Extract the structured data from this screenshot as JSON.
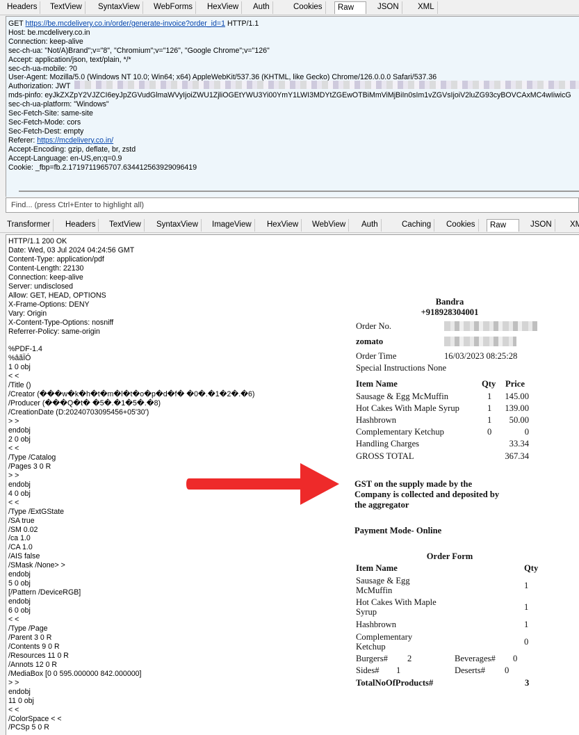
{
  "request_tabs": [
    "Headers",
    "TextView",
    "SyntaxView",
    "WebForms",
    "HexView",
    "Auth",
    "Cookies",
    "Raw",
    "JSON",
    "XML"
  ],
  "request_active_tab": "Raw",
  "request": {
    "line1_method": "GET ",
    "line1_url": "https://be.mcdelivery.co.in/order/generate-invoice?order_id=1",
    "line1_proto": " HTTP/1.1",
    "lines_a": [
      "Host: be.mcdelivery.co.in",
      "Connection: keep-alive",
      "sec-ch-ua: \"Not/A)Brand\";v=\"8\", \"Chromium\";v=\"126\", \"Google Chrome\";v=\"126\"",
      "Accept: application/json, text/plain, */*",
      "sec-ch-ua-mobile: ?0",
      "User-Agent: Mozilla/5.0 (Windows NT 10.0; Win64; x64) AppleWebKit/537.36 (KHTML, like Gecko) Chrome/126.0.0.0 Safari/537.36",
      "Authorization: JWT",
      "mds-pinfo: eyJkZXZpY2VJZCI6eyJpZGVudGlmaWVyIjoiZWU1ZjliOGEtYWU3Yi00YmY1LWI3MDYtZGEwOTBiMmViMjBiIn0sIm1vZGVsIjoiV2luZG93cyBOVCAxMC4wIiwicG",
      "sec-ch-ua-platform: \"Windows\"",
      "Sec-Fetch-Site: same-site",
      "Sec-Fetch-Mode: cors",
      "Sec-Fetch-Dest: empty"
    ],
    "referer_label": "Referer: ",
    "referer_url": "https://mcdelivery.co.in/",
    "lines_b": [
      "Accept-Encoding: gzip, deflate, br, zstd",
      "Accept-Language: en-US,en;q=0.9",
      "Cookie: _fbp=fb.2.1719711965707.634412563929096419"
    ]
  },
  "find_placeholder": "Find... (press Ctrl+Enter to highlight all)",
  "response_tabs": [
    "Transformer",
    "Headers",
    "TextView",
    "SyntaxView",
    "ImageView",
    "HexView",
    "WebView",
    "Auth",
    "Caching",
    "Cookies",
    "Raw",
    "JSON",
    "XML"
  ],
  "response_active_tab": "Raw",
  "response_lines": [
    "HTTP/1.1 200 OK",
    "Date: Wed, 03 Jul 2024 04:24:56 GMT",
    "Content-Type: application/pdf",
    "Content-Length: 22130",
    "Connection: keep-alive",
    "Server: undisclosed",
    "Allow: GET, HEAD, OPTIONS",
    "X-Frame-Options: DENY",
    "Vary: Origin",
    "X-Content-Type-Options: nosniff",
    "Referrer-Policy: same-origin",
    "",
    "%PDF-1.4",
    "%âãÏÓ",
    "1 0 obj",
    "< <",
    "/Title ()",
    "/Creator (���w�k�h�t�m�l�t�o�p�d�f� �0�.�1�2�.�6)",
    "/Producer (���Q�t� �5�.�1�5�.�8)",
    "/CreationDate (D:20240703095456+05'30')",
    "> >",
    "endobj",
    "2 0 obj",
    "< <",
    "/Type /Catalog",
    "/Pages 3 0 R",
    "> >",
    "endobj",
    "4 0 obj",
    "< <",
    "/Type /ExtGState",
    "/SA true",
    "/SM 0.02",
    "/ca 1.0",
    "/CA 1.0",
    "/AIS false",
    "/SMask /None> >",
    "endobj",
    "5 0 obj",
    "[/Pattern /DeviceRGB]",
    "endobj",
    "6 0 obj",
    "< <",
    "/Type /Page",
    "/Parent 3 0 R",
    "/Contents 9 0 R",
    "/Resources 11 0 R",
    "/Annots 12 0 R",
    "/MediaBox [0 0 595.000000 842.000000]",
    "> >",
    "endobj",
    "11 0 obj",
    "< <",
    "/ColorSpace < <",
    "/PCSp 5 0 R"
  ],
  "invoice": {
    "store": "Bandra",
    "phone": "+918928304001",
    "order_no_label": "Order No.",
    "aggregator": "zomato",
    "order_time_label": "Order Time",
    "order_time": "16/03/2023 08:25:28",
    "special_instructions": "Special Instructions None",
    "col_item": "Item Name",
    "col_qty": "Qty",
    "col_price": "Price",
    "items": [
      {
        "name": "Sausage & Egg McMuffin",
        "qty": "1",
        "price": "145.00"
      },
      {
        "name": "Hot Cakes With Maple Syrup",
        "qty": "1",
        "price": "139.00"
      },
      {
        "name": "Hashbrown",
        "qty": "1",
        "price": "50.00"
      },
      {
        "name": "Complementary Ketchup",
        "qty": "0",
        "price": "0"
      }
    ],
    "handling_label": "Handling Charges",
    "handling": "33.34",
    "gross_label": "GROSS TOTAL",
    "gross": "367.34",
    "gst_line1": "GST on the supply made by the",
    "gst_line2": "Company is collected and deposited by",
    "gst_line3": "the aggregator",
    "payment_mode": "Payment Mode- Online",
    "order_form_title": "Order Form",
    "form_col_item": "Item Name",
    "form_col_qty": "Qty",
    "form_items": [
      {
        "line1": "Sausage & Egg",
        "line2": "McMuffin",
        "qty": "1"
      },
      {
        "line1": "Hot Cakes With Maple",
        "line2": "Syrup",
        "qty": "1"
      },
      {
        "line1": "Hashbrown",
        "line2": "",
        "qty": "1"
      },
      {
        "line1": "Complementary",
        "line2": "Ketchup",
        "qty": "0"
      }
    ],
    "burgers_label": "Burgers#",
    "burgers": "2",
    "beverages_label": "Beverages#",
    "beverages": "0",
    "sides_label": "Sides#",
    "sides": "1",
    "deserts_label": "Deserts#",
    "deserts": "0",
    "total_label": "TotalNoOfProducts#",
    "total": "3"
  },
  "colors": {
    "arrow": "#ee2a2a",
    "request_bg": "#eef6fb",
    "link": "#0645ad"
  }
}
